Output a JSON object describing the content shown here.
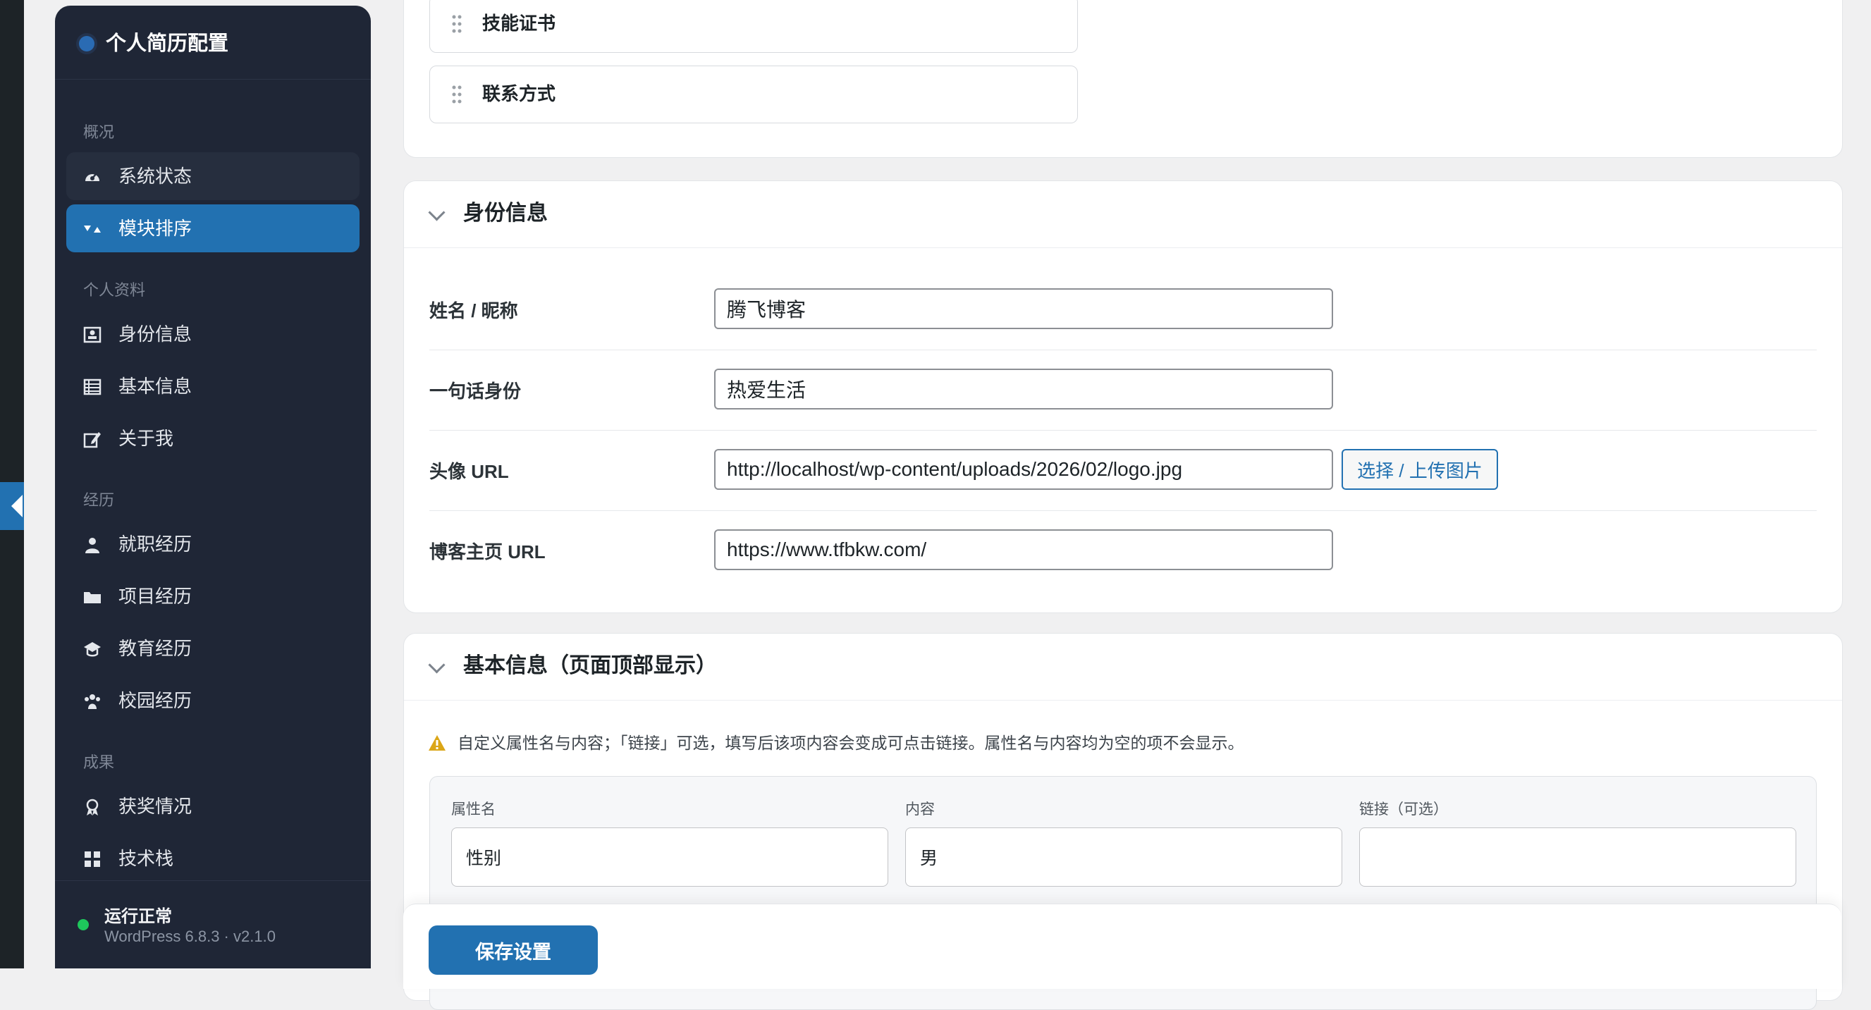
{
  "sidebar": {
    "title": "个人简历配置",
    "sections": [
      "概况",
      "个人资料",
      "经历",
      "成果"
    ],
    "items": [
      {
        "label": "系统状态",
        "icon": "dashboard-icon"
      },
      {
        "label": "模块排序",
        "icon": "sort-icon"
      },
      {
        "label": "身份信息",
        "icon": "id-card-icon"
      },
      {
        "label": "基本信息",
        "icon": "table-icon"
      },
      {
        "label": "关于我",
        "icon": "edit-icon"
      },
      {
        "label": "就职经历",
        "icon": "person-icon"
      },
      {
        "label": "项目经历",
        "icon": "folder-icon"
      },
      {
        "label": "教育经历",
        "icon": "graduation-cap-icon"
      },
      {
        "label": "校园经历",
        "icon": "group-icon"
      },
      {
        "label": "获奖情况",
        "icon": "award-icon"
      },
      {
        "label": "技术栈",
        "icon": "grid-icon"
      }
    ],
    "active_index": 1,
    "status": "运行正常",
    "version": "WordPress 6.8.3 · v2.1.0"
  },
  "modules": [
    "技能证书",
    "联系方式"
  ],
  "identity": {
    "title": "身份信息",
    "name_label": "姓名 / 昵称",
    "name_value": "腾飞博客",
    "tagline_label": "一句话身份",
    "tagline_value": "热爱生活",
    "avatar_label": "头像 URL",
    "avatar_value": "http://localhost/wp-content/uploads/2026/02/logo.jpg",
    "upload_label": "选择 / 上传图片",
    "blog_label": "博客主页 URL",
    "blog_value": "https://www.tfbkw.com/"
  },
  "basic": {
    "title": "基本信息（页面顶部显示）",
    "notice": "自定义属性名与内容；「链接」可选，填写后该项内容会变成可点击链接。属性名与内容均为空的项不会显示。",
    "col_name": "属性名",
    "col_content": "内容",
    "col_link": "链接（可选）",
    "row1_name": "性别",
    "row1_content": "男",
    "row1_link": ""
  },
  "save_label": "保存设置",
  "colors": {
    "accent": "#2271b1",
    "sidebar_bg": "#1f2636",
    "status_ok": "#1ec75c",
    "warning": "#dba617"
  }
}
